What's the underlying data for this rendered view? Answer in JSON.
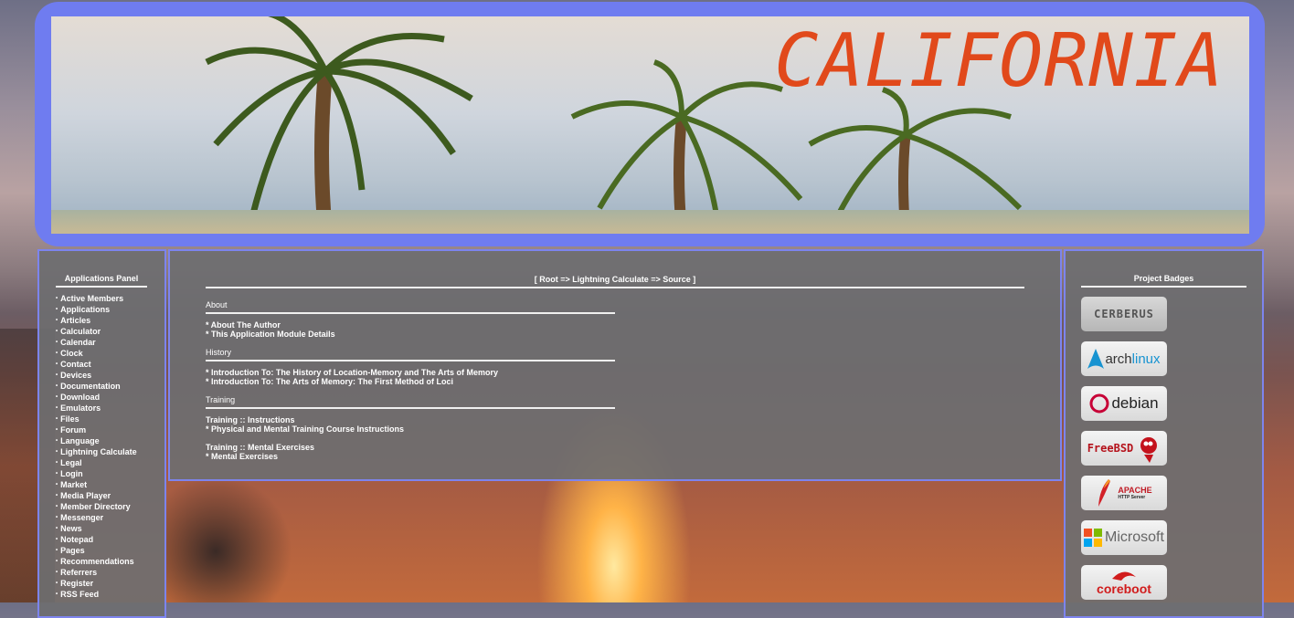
{
  "banner": {
    "title": "CALIFORNIA"
  },
  "left_panel": {
    "title": "Applications Panel",
    "items": [
      "Active Members",
      "Applications",
      "Articles",
      "Calculator",
      "Calendar",
      "Clock",
      "Contact",
      "Devices",
      "Documentation",
      "Download",
      "Emulators",
      "Files",
      "Forum",
      "Language",
      "Lightning Calculate",
      "Legal",
      "Login",
      "Market",
      "Media Player",
      "Member Directory",
      "Messenger",
      "News",
      "Notepad",
      "Pages",
      "Recommendations",
      "Referrers",
      "Register",
      "RSS Feed"
    ]
  },
  "main": {
    "breadcrumb": "[ Root => Lightning Calculate => Source ]",
    "sections": [
      {
        "heading": "About",
        "links": [
          "* About The Author",
          "* This Application Module Details"
        ]
      },
      {
        "heading": "History",
        "links": [
          "* Introduction To: The History of Location-Memory and The Arts of Memory",
          "* Introduction To: The Arts of Memory: The First Method of Loci"
        ]
      },
      {
        "heading": "Training",
        "links": [
          "Training :: Instructions",
          "* Physical and Mental Training Course Instructions",
          "",
          "Training :: Mental Exercises",
          "* Mental Exercises"
        ]
      }
    ]
  },
  "right_panel": {
    "title": "Project Badges",
    "badges": [
      {
        "icon": "cerberus-logo-icon",
        "text": "CERBERUS"
      },
      {
        "icon": "archlinux-logo-icon",
        "text_a": "arch",
        "text_b": "linux"
      },
      {
        "icon": "debian-logo-icon",
        "text": "debian"
      },
      {
        "icon": "freebsd-logo-icon",
        "text": "FreeBSD"
      },
      {
        "icon": "apache-logo-icon",
        "text": "APACHE",
        "subtext": "HTTP Server"
      },
      {
        "icon": "microsoft-logo-icon",
        "text": "Microsoft"
      },
      {
        "icon": "coreboot-logo-icon",
        "text": "coreboot"
      }
    ]
  },
  "colors": {
    "panel_border": "#7d84ee",
    "banner_frame": "#6f7cf0",
    "title_orange": "#e1491b",
    "panel_bg": "#6e6e70"
  }
}
